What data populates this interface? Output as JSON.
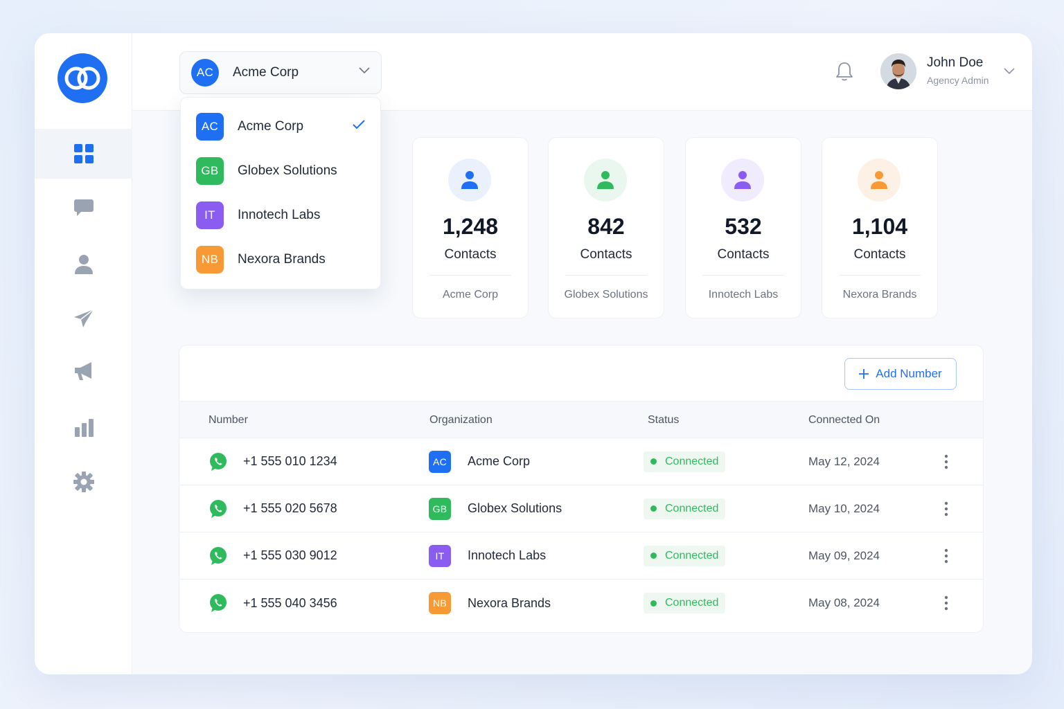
{
  "colors": {
    "accent": "#1f6ff2",
    "acme": "#1f6ff2",
    "globex": "#2fba5d",
    "innotech": "#8a5cf0",
    "nexora": "#f79a36",
    "connected": "#2fba5d"
  },
  "sidebar": {
    "items": [
      {
        "name": "dashboard",
        "icon": "grid-icon",
        "active": true
      },
      {
        "name": "messages",
        "icon": "chat-icon"
      },
      {
        "name": "contacts",
        "icon": "user-icon"
      },
      {
        "name": "campaigns",
        "icon": "send-icon"
      },
      {
        "name": "broadcasts",
        "icon": "megaphone-icon"
      },
      {
        "name": "analytics",
        "icon": "bar-chart-icon"
      },
      {
        "name": "settings",
        "icon": "gear-icon"
      }
    ]
  },
  "header": {
    "org_select": {
      "badge": "AC",
      "name": "Acme Corp"
    },
    "user": {
      "name": "John Doe",
      "role": "Agency Admin"
    }
  },
  "dropdown": {
    "items": [
      {
        "badge": "AC",
        "label": "Acme Corp",
        "selected": true
      },
      {
        "badge": "GB",
        "label": "Globex Solutions"
      },
      {
        "badge": "IT",
        "label": "Innotech Labs"
      },
      {
        "badge": "NB",
        "label": "Nexora Brands"
      }
    ]
  },
  "stats": [
    {
      "value": "1,248",
      "unit": "Contacts",
      "org": "Acme Corp"
    },
    {
      "value": "842",
      "unit": "Contacts",
      "org": "Globex Solutions"
    },
    {
      "value": "532",
      "unit": "Contacts",
      "org": "Innotech Labs"
    },
    {
      "value": "1,104",
      "unit": "Contacts",
      "org": "Nexora Brands"
    }
  ],
  "table": {
    "add_button": "Add Number",
    "columns": [
      "Number",
      "Organization",
      "Status",
      "Connected On"
    ],
    "rows": [
      {
        "number": "+1 555 010 1234",
        "badge": "AC",
        "org": "Acme Corp",
        "status": "Connected",
        "date": "May 12, 2024"
      },
      {
        "number": "+1 555 020 5678",
        "badge": "GB",
        "org": "Globex Solutions",
        "status": "Connected",
        "date": "May 10, 2024"
      },
      {
        "number": "+1 555 030 9012",
        "badge": "IT",
        "org": "Innotech Labs",
        "status": "Connected",
        "date": "May 09, 2024"
      },
      {
        "number": "+1 555 040 3456",
        "badge": "NB",
        "org": "Nexora Brands",
        "status": "Connected",
        "date": "May 08, 2024"
      }
    ]
  }
}
